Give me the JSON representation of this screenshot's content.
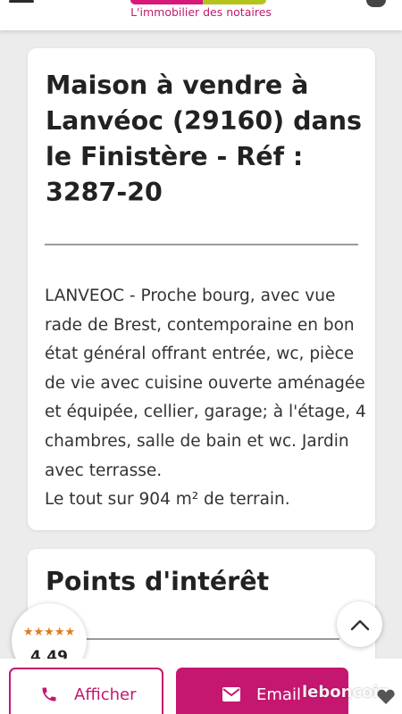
{
  "header": {
    "tagline": "L'immobilier des notaires",
    "brand_colors": {
      "pink": "#d6197a",
      "green": "#b4c41a"
    },
    "icons": {
      "menu": "hamburger-menu-icon",
      "account": "user-icon"
    }
  },
  "listing": {
    "title": "Maison à vendre à Lanvéoc (29160) dans le Finistère - Réf : 3287-20",
    "description": [
      "LANVEOC - Proche bourg, avec vue rade de Brest, contemporaine en bon état général offrant entrée, wc, pièce de vie avec cuisine ouverte aménagée et équipée, cellier, garage; à l'étage, 4 chambres, salle de bain et wc. Jardin avec terrasse.",
      "Le tout sur 904 m² de terrain."
    ]
  },
  "poi": {
    "title": "Points d'intérêt"
  },
  "rating": {
    "stars": "★★★★★",
    "value": "4,49",
    "star_color": "#e07b1a"
  },
  "actions": {
    "call_label": "Afficher",
    "email_label": "Email",
    "accent": "#c5176f",
    "icons": {
      "call": "phone-icon",
      "email": "envelope-icon",
      "scroll_top": "chevron-up-icon"
    }
  },
  "watermark": {
    "text": "leboncoin"
  }
}
